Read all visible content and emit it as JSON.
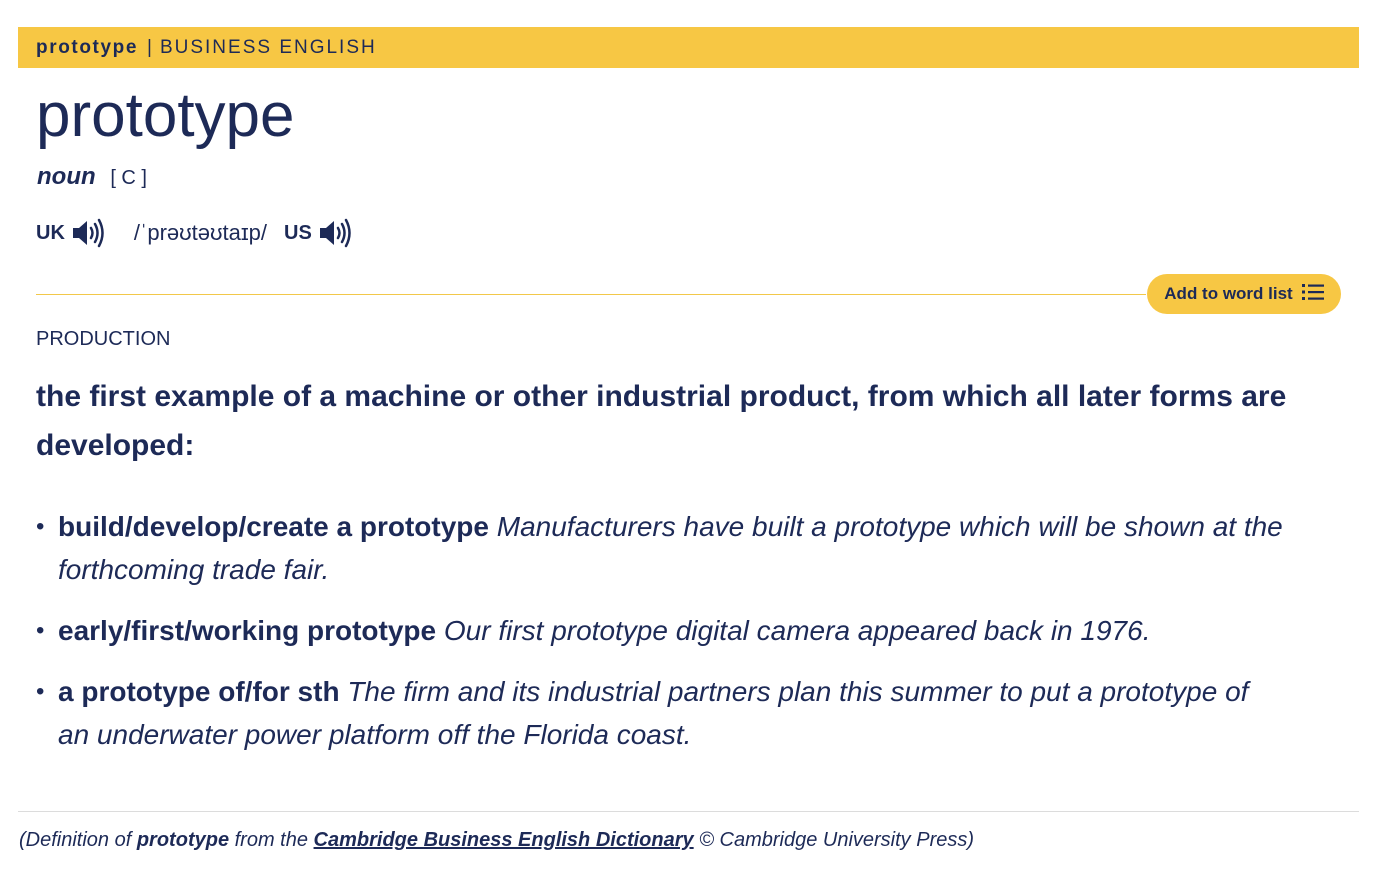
{
  "header": {
    "word": "prototype",
    "separator": "|",
    "source": "BUSINESS ENGLISH"
  },
  "entry": {
    "headword": "prototype",
    "pos": "noun",
    "grammar": "[ C ]",
    "pron": {
      "uk_label": "UK",
      "ipa": "/ˈprəʊtəʊtaɪp/",
      "us_label": "US"
    }
  },
  "actions": {
    "add_to_word_list": "Add to word list"
  },
  "sense": {
    "domain": "PRODUCTION",
    "definition": "the first example of a machine or other industrial product, from which all later forms are developed:",
    "examples": [
      {
        "collocation": "build/develop/create a prototype",
        "text": "Manufacturers have built a prototype which will be shown at the forthcoming trade fair."
      },
      {
        "collocation": "early/first/working prototype",
        "text": "Our first prototype digital camera appeared back in 1976."
      },
      {
        "collocation": "a prototype of/for sth",
        "text": "The firm and its industrial partners plan this summer to put a prototype of an underwater power platform off the Florida coast."
      }
    ]
  },
  "footer": {
    "prefix": "(Definition of",
    "word": "prototype",
    "middle": "from the",
    "dictionary": "Cambridge Business English Dictionary",
    "suffix": "© Cambridge University Press)"
  },
  "icons": {
    "speaker": "speaker-icon",
    "list": "list-icon"
  },
  "colors": {
    "accent": "#f7c744",
    "text": "#1d2a57"
  }
}
